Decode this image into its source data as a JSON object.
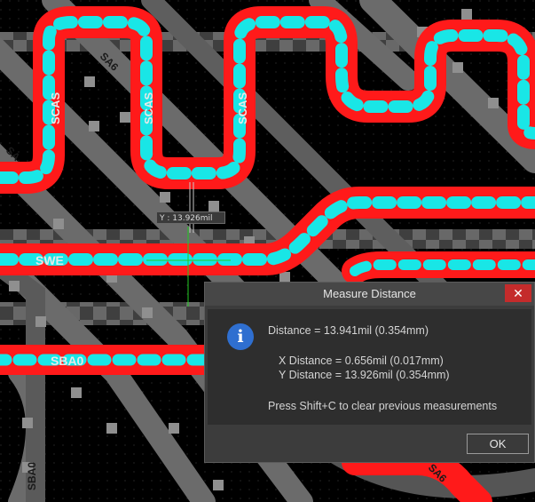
{
  "board": {
    "net_labels": {
      "sa6_top": "SA6",
      "scas_1": "SCAS",
      "scas_2": "SCAS",
      "scas_3": "SCAS",
      "sa_left": "SA",
      "swe": "SWE",
      "sba0_horizontal": "SBA0",
      "sba0_vertical": "SBA0",
      "sa6_bottom": "SA6"
    },
    "colors": {
      "background": "#000000",
      "trace_red": "#ff1a1a",
      "trace_grey": "#6b6b6b",
      "via_cyan": "#19e6e6",
      "crosshair": "#22cc22"
    }
  },
  "tooltip": {
    "text": "Y : 13.926mil"
  },
  "dialog": {
    "title": "Measure Distance",
    "close_glyph": "✕",
    "icon": "info-icon",
    "distance": "Distance = 13.941mil (0.354mm)",
    "x_distance": "X Distance = 0.656mil (0.017mm)",
    "y_distance": "Y Distance = 13.926mil (0.354mm)",
    "hint": "Press Shift+C to clear previous measurements",
    "ok_label": "OK"
  }
}
